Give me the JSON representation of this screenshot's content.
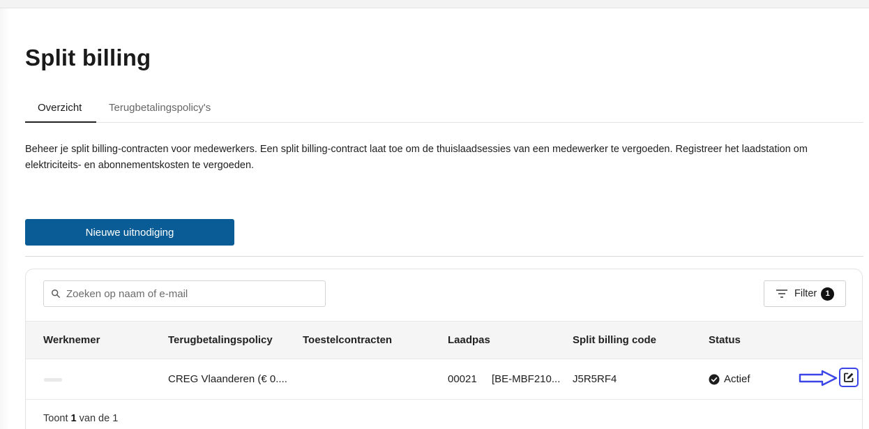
{
  "page": {
    "title": "Split billing",
    "tabs": [
      {
        "label": "Overzicht",
        "active": true
      },
      {
        "label": "Terugbetalingspolicy's",
        "active": false
      }
    ],
    "description": "Beheer je split billing-contracten voor medewerkers. Een split billing-contract laat toe om de thuislaadsessies van een medewerker te vergoeden. Registreer het laadstation om elektriciteits- en abonnementskosten te vergoeden.",
    "new_invite_label": "Nieuwe uitnodiging"
  },
  "toolbar": {
    "search_placeholder": "Zoeken op naam of e-mail",
    "filter_label": "Filter",
    "filter_count": "1"
  },
  "table": {
    "columns": [
      "Werknemer",
      "Terugbetalingspolicy",
      "Toestelcontracten",
      "Laadpas",
      "Split billing code",
      "Status"
    ],
    "rows": [
      {
        "employee": "",
        "policy": "CREG Vlaanderen (€ 0....",
        "device_contracts": "",
        "card_number": "00021",
        "card_id": "[BE-MBF210...",
        "split_billing_code": "J5R5RF4",
        "status": "Actief"
      }
    ]
  },
  "footer": {
    "prefix": "Toont",
    "shown": "1",
    "middle": "van de",
    "total": "1"
  },
  "icons": {
    "search": "search-icon",
    "filter": "filter-lines-icon",
    "status": "check-circle-icon",
    "edit": "edit-icon",
    "annotation": "arrow-right-icon"
  },
  "colors": {
    "primary": "#0a5c96",
    "annotation": "#3b44e6",
    "badge": "#111111"
  }
}
